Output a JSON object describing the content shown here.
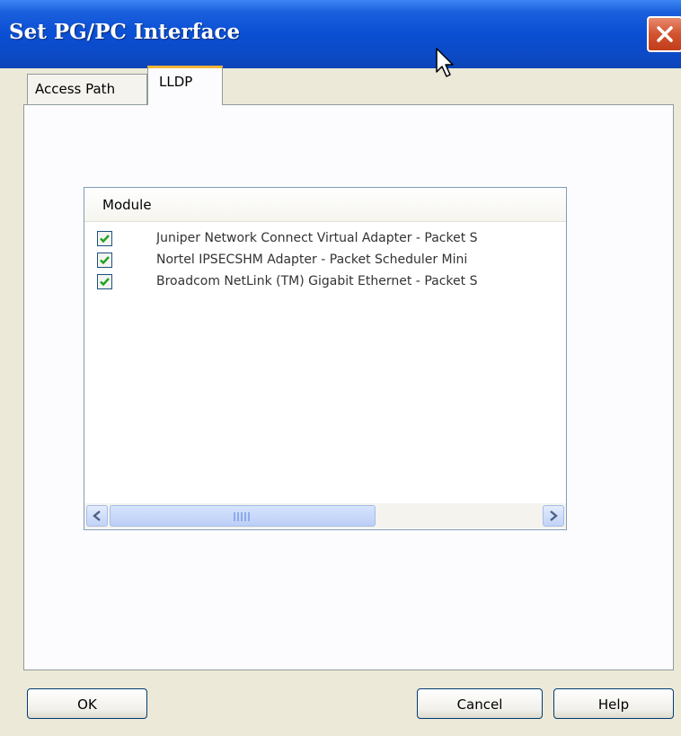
{
  "window": {
    "title": "Set PG/PC Interface"
  },
  "tabs": [
    {
      "label": "Access Path",
      "active": false
    },
    {
      "label": "LLDP",
      "active": true
    }
  ],
  "module_list": {
    "header": "Module",
    "rows": [
      {
        "checked": true,
        "label": "Juniper Network Connect Virtual Adapter - Packet S"
      },
      {
        "checked": true,
        "label": "Nortel IPSECSHM Adapter - Packet Scheduler Mini"
      },
      {
        "checked": true,
        "label": "Broadcom NetLink (TM) Gigabit Ethernet - Packet S"
      }
    ]
  },
  "buttons": {
    "ok": "OK",
    "cancel": "Cancel",
    "help": "Help"
  },
  "colors": {
    "titlebar": "#0a4fd4",
    "dialog_background": "#ece9d8",
    "active_tab_accent": "#f2b53a",
    "close_button": "#d3532f",
    "checkmark": "#21a121"
  },
  "icons": {
    "close": "close-icon",
    "cursor": "mouse-cursor-icon",
    "scroll_left": "scroll-left-arrow-icon",
    "scroll_right": "scroll-right-arrow-icon",
    "checkmark": "checkmark-icon"
  }
}
